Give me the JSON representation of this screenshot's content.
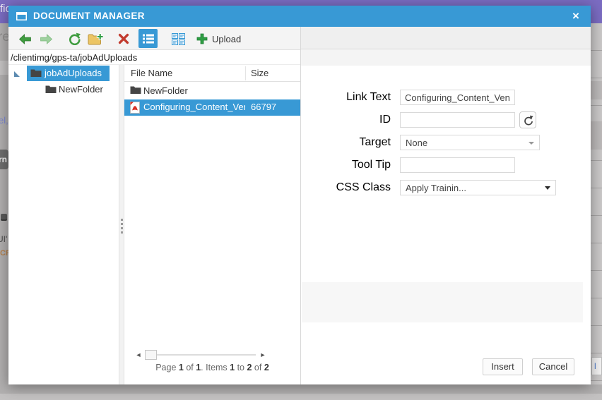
{
  "window": {
    "title": "DOCUMENT MANAGER",
    "close_symbol": "×"
  },
  "toolbar": {
    "upload_label": "Upload"
  },
  "breadcrumb": {
    "path": "/clientimg/gps-ta/jobAdUploads"
  },
  "tree": {
    "items": [
      {
        "label": "jobAdUploads",
        "selected": true
      },
      {
        "label": "NewFolder",
        "selected": false
      }
    ]
  },
  "file_list": {
    "columns": {
      "name": "File Name",
      "size": "Size"
    },
    "rows": [
      {
        "name": "NewFolder",
        "size": "",
        "type": "folder",
        "selected": false
      },
      {
        "name": "Configuring_Content_Vendor",
        "size": "66797",
        "type": "pdf",
        "selected": true
      }
    ]
  },
  "pager": {
    "s": [
      "Page ",
      "1",
      " of ",
      "1",
      ". Items ",
      "1",
      " to ",
      "2",
      " of ",
      "2"
    ]
  },
  "form": {
    "link_text_label": "Link Text",
    "link_text_value": "Configuring_Content_Vendor",
    "id_label": "ID",
    "id_value": "",
    "target_label": "Target",
    "target_value": "None",
    "tool_tip_label": "Tool Tip",
    "tool_tip_value": "",
    "css_class_label": "CSS Class",
    "css_class_value": "Apply Trainin..."
  },
  "footer": {
    "insert_label": "Insert",
    "cancel_label": "Cancel"
  },
  "background": {
    "fragments": [
      "fic",
      "re",
      "el,",
      "rn",
      "UI'",
      "CRI",
      "l"
    ]
  },
  "colors": {
    "accent_blue": "#3899d5",
    "purple_header": "#7b6cc2",
    "delete_red": "#c23b2e",
    "toolbar_green": "#3f9c3f",
    "folder_yellow": "#ecc565",
    "selection_text": "#ffffff"
  }
}
